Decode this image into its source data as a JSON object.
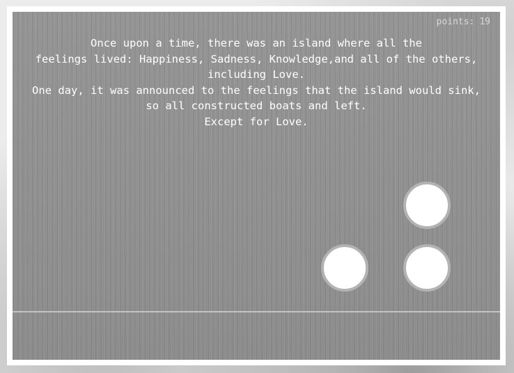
{
  "hud": {
    "points_label": "points:",
    "points_value": "19"
  },
  "story": {
    "lines": [
      "Once upon a time, there was an island where all the",
      "feelings lived: Happiness, Sadness, Knowledge,and all of the others,",
      "including Love.",
      "One day, it was announced to the feelings that the island would sink,",
      "so all constructed boats and left.",
      "Except for Love."
    ]
  },
  "colors": {
    "stage_background": "#8f8f8f",
    "orb_fill": "#ffffff",
    "orb_ring": "#b3b3b3",
    "ground_line": "#c4c4c4",
    "frame": "#ffffff"
  }
}
